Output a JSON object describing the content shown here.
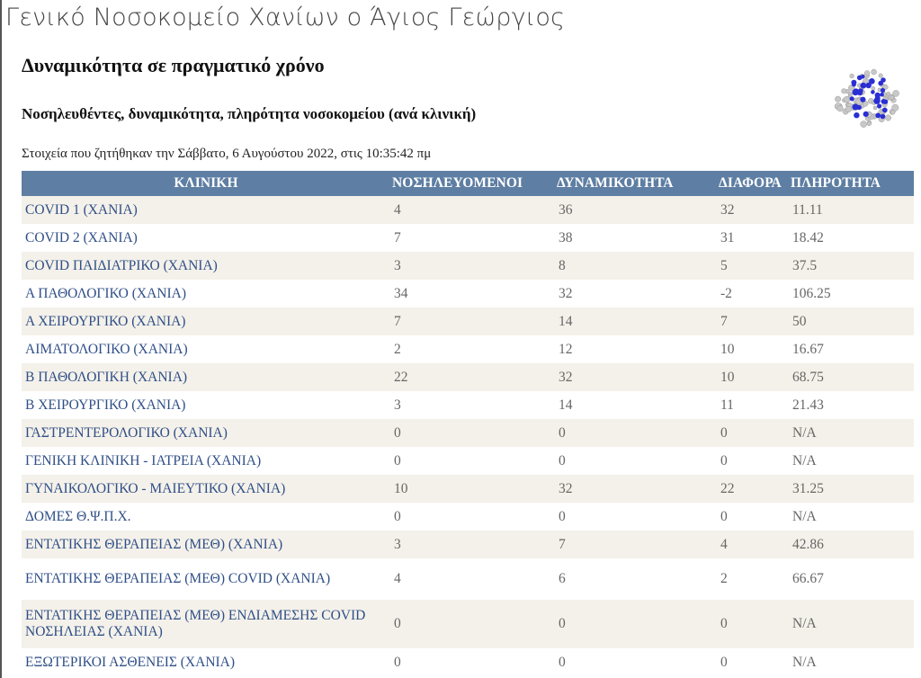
{
  "header": {
    "hospital_name": "Γενικό Νοσοκομείο Χανίων ο Άγιος Γεώργιος",
    "title": "Δυναμικότητα σε πραγματικό χρόνο",
    "subtitle": "Νοσηλευθέντες, δυναμικότητα, πληρότητα νοσοκομείου (ανά κλινική)",
    "request_info": "Στοιχεία που ζητήθηκαν την Σάββατο, 6 Αυγούστου 2022, στις 10:35:42 πμ",
    "logo_icon": "molecule-logo-icon"
  },
  "table": {
    "columns": [
      "ΚΛΙΝΙΚΗ",
      "ΝΟΣΗΛΕΥΟΜΕΝΟΙ",
      "ΔΥΝΑΜΙΚΟΤΗΤΑ",
      "ΔΙΑΦΟΡΑ",
      "ΠΛΗΡΟΤΗΤΑ"
    ],
    "rows": [
      {
        "clinic": "COVID 1 (ΧΑΝΙΑ)",
        "patients": "4",
        "capacity": "36",
        "difference": "32",
        "occupancy": "11.11"
      },
      {
        "clinic": "COVID 2 (ΧΑΝΙΑ)",
        "patients": "7",
        "capacity": "38",
        "difference": "31",
        "occupancy": "18.42"
      },
      {
        "clinic": "COVID ΠΑΙΔΙΑΤΡΙΚΟ (ΧΑΝΙΑ)",
        "patients": "3",
        "capacity": "8",
        "difference": "5",
        "occupancy": "37.5"
      },
      {
        "clinic": "Α ΠΑΘΟΛΟΓΙΚΟ (ΧΑΝΙΑ)",
        "patients": "34",
        "capacity": "32",
        "difference": "-2",
        "occupancy": "106.25"
      },
      {
        "clinic": "Α ΧΕΙΡΟΥΡΓΙΚΟ (ΧΑΝΙΑ)",
        "patients": "7",
        "capacity": "14",
        "difference": "7",
        "occupancy": "50"
      },
      {
        "clinic": "ΑΙΜΑΤΟΛΟΓΙΚΟ (ΧΑΝΙΑ)",
        "patients": "2",
        "capacity": "12",
        "difference": "10",
        "occupancy": "16.67"
      },
      {
        "clinic": "Β ΠΑΘΟΛΟΓΙΚΗ (ΧΑΝΙΑ)",
        "patients": "22",
        "capacity": "32",
        "difference": "10",
        "occupancy": "68.75"
      },
      {
        "clinic": "Β ΧΕΙΡΟΥΡΓΙΚΟ (ΧΑΝΙΑ)",
        "patients": "3",
        "capacity": "14",
        "difference": "11",
        "occupancy": "21.43"
      },
      {
        "clinic": "ΓΑΣΤΡΕΝΤΕΡΟΛΟΓΙΚΟ (ΧΑΝΙΑ)",
        "patients": "0",
        "capacity": "0",
        "difference": "0",
        "occupancy": "N/A"
      },
      {
        "clinic": "ΓΕΝΙΚΗ ΚΛΙΝΙΚΗ - ΙΑΤΡΕΙΑ (ΧΑΝΙΑ)",
        "patients": "0",
        "capacity": "0",
        "difference": "0",
        "occupancy": "N/A"
      },
      {
        "clinic": "ΓΥΝΑΙΚΟΛΟΓΙΚΟ - ΜΑΙΕΥΤΙΚΟ (ΧΑΝΙΑ)",
        "patients": "10",
        "capacity": "32",
        "difference": "22",
        "occupancy": "31.25"
      },
      {
        "clinic": "ΔΟΜΕΣ Θ.Ψ.Π.Χ.",
        "patients": "0",
        "capacity": "0",
        "difference": "0",
        "occupancy": "N/A"
      },
      {
        "clinic": "ΕΝΤΑΤΙΚΗΣ ΘΕΡΑΠΕΙΑΣ (ΜΕΘ) (ΧΑΝΙΑ)",
        "patients": "3",
        "capacity": "7",
        "difference": "4",
        "occupancy": "42.86"
      },
      {
        "clinic": "ΕΝΤΑΤΙΚΗΣ ΘΕΡΑΠΕΙΑΣ (ΜΕΘ) COVID (ΧΑΝΙΑ)",
        "patients": "4",
        "capacity": "6",
        "difference": "2",
        "occupancy": "66.67"
      },
      {
        "clinic": "ΕΝΤΑΤΙΚΗΣ ΘΕΡΑΠΕΙΑΣ (ΜΕΘ) ΕΝΔΙΑΜΕΣΗΣ COVID ΝΟΣΗΛΕΙΑΣ (ΧΑΝΙΑ)",
        "patients": "0",
        "capacity": "0",
        "difference": "0",
        "occupancy": "N/A"
      },
      {
        "clinic": "ΕΞΩΤΕΡΙΚΟΙ ΑΣΘΕΝΕΙΣ (ΧΑΝΙΑ)",
        "patients": "0",
        "capacity": "0",
        "difference": "0",
        "occupancy": "N/A"
      }
    ]
  },
  "colors": {
    "header_bg": "#5e7ea3",
    "row_alt_bg": "#f4f1ea",
    "clinic_link": "#2f4f87",
    "logo_blue": "#2a2fd4",
    "logo_grey": "#c8c8c8"
  }
}
